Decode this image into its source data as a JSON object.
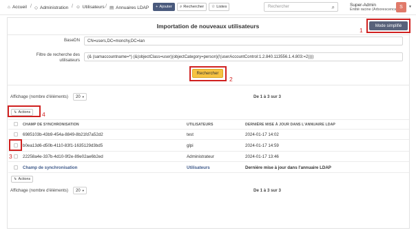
{
  "breadcrumb": {
    "home": "Accueil",
    "admin": "Administration",
    "users": "Utilisateurs",
    "ldap": "Annuaires LDAP"
  },
  "toolbar": {
    "add": "Ajouter",
    "search": "Rechercher",
    "lists": "Listes"
  },
  "search": {
    "placeholder": "Rechercher"
  },
  "user": {
    "name": "Super-Admin",
    "entity": "Entité racine (Arborescence)",
    "avatar_initial": "S"
  },
  "page": {
    "title": "Importation de nouveaux utilisateurs",
    "mode_button": "Mode simplifié"
  },
  "form": {
    "basedn_label": "BaseDN",
    "basedn_value": "CN=users,DC=monchy,DC=lan",
    "filter_label_1": "Filtre de recherche des",
    "filter_label_2": "utilisateurs",
    "filter_value": "(& (samaccountname=*) (&(objectClass=user)(objectCategory=person)(!(userAccountControl:1.2.840.113556.1.4.803:=2))))",
    "search_button": "Rechercher"
  },
  "listing": {
    "display_label": "Affichage (nombre d'éléments)",
    "display_count": "20",
    "range_text": "De 1 à 3 sur 3",
    "actions_label": "Actions",
    "columns": [
      "CHAMP DE SYNCHRONISATION",
      "UTILISATEURS",
      "DERNIÈRE MISE À JOUR DANS L'ANNUAIRE LDAP"
    ],
    "rows": [
      {
        "sync": "6985103b-43b9-454a-8849-8b21fd7a52d2",
        "user": "test",
        "date": "2024-01-17 14:02"
      },
      {
        "sync": "b0ea13d6-d50b-4110-83f1-1635129d3bd5",
        "user": "glpi",
        "date": "2024-01-17 14:59"
      },
      {
        "sync": "22258a4e-337b-4d10-9f2e-89e02ae6b2ed",
        "user": "Administrateur",
        "date": "2024-01-17 13:46"
      }
    ],
    "footer": [
      "Champ de synchronisation",
      "Utilisateurs",
      "Dernière mise à jour dans l'annuaire LDAP"
    ]
  },
  "annotations": {
    "n1": "1",
    "n2": "2",
    "n3": "3",
    "n4": "4"
  },
  "colors": {
    "highlight": "#d0201f",
    "search_button": "#f6c342",
    "mode_button": "#59627a",
    "add_button": "#4a5a7d"
  }
}
